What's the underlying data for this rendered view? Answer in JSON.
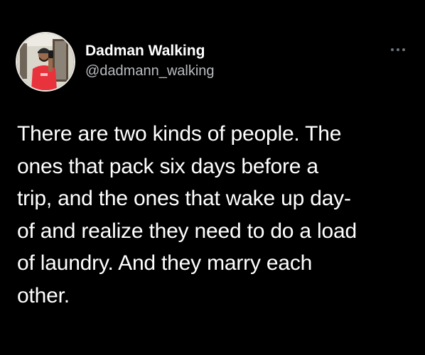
{
  "author": {
    "display_name": "Dadman Walking",
    "handle": "@dadmann_walking"
  },
  "icons": {
    "more": "more-horizontal-icon",
    "avatar": "avatar-photo"
  },
  "tweet": {
    "lines": [
      "There are two kinds of people. The",
      "ones that pack six days before a",
      "trip, and the ones that wake up day-",
      "of and realize they need to do a load",
      "of laundry. And they marry each",
      "other."
    ]
  },
  "colors": {
    "background": "#000000",
    "text": "#ffffff",
    "secondary_text": "#b9bcc0",
    "avatar_shirt": "#e8323c"
  }
}
